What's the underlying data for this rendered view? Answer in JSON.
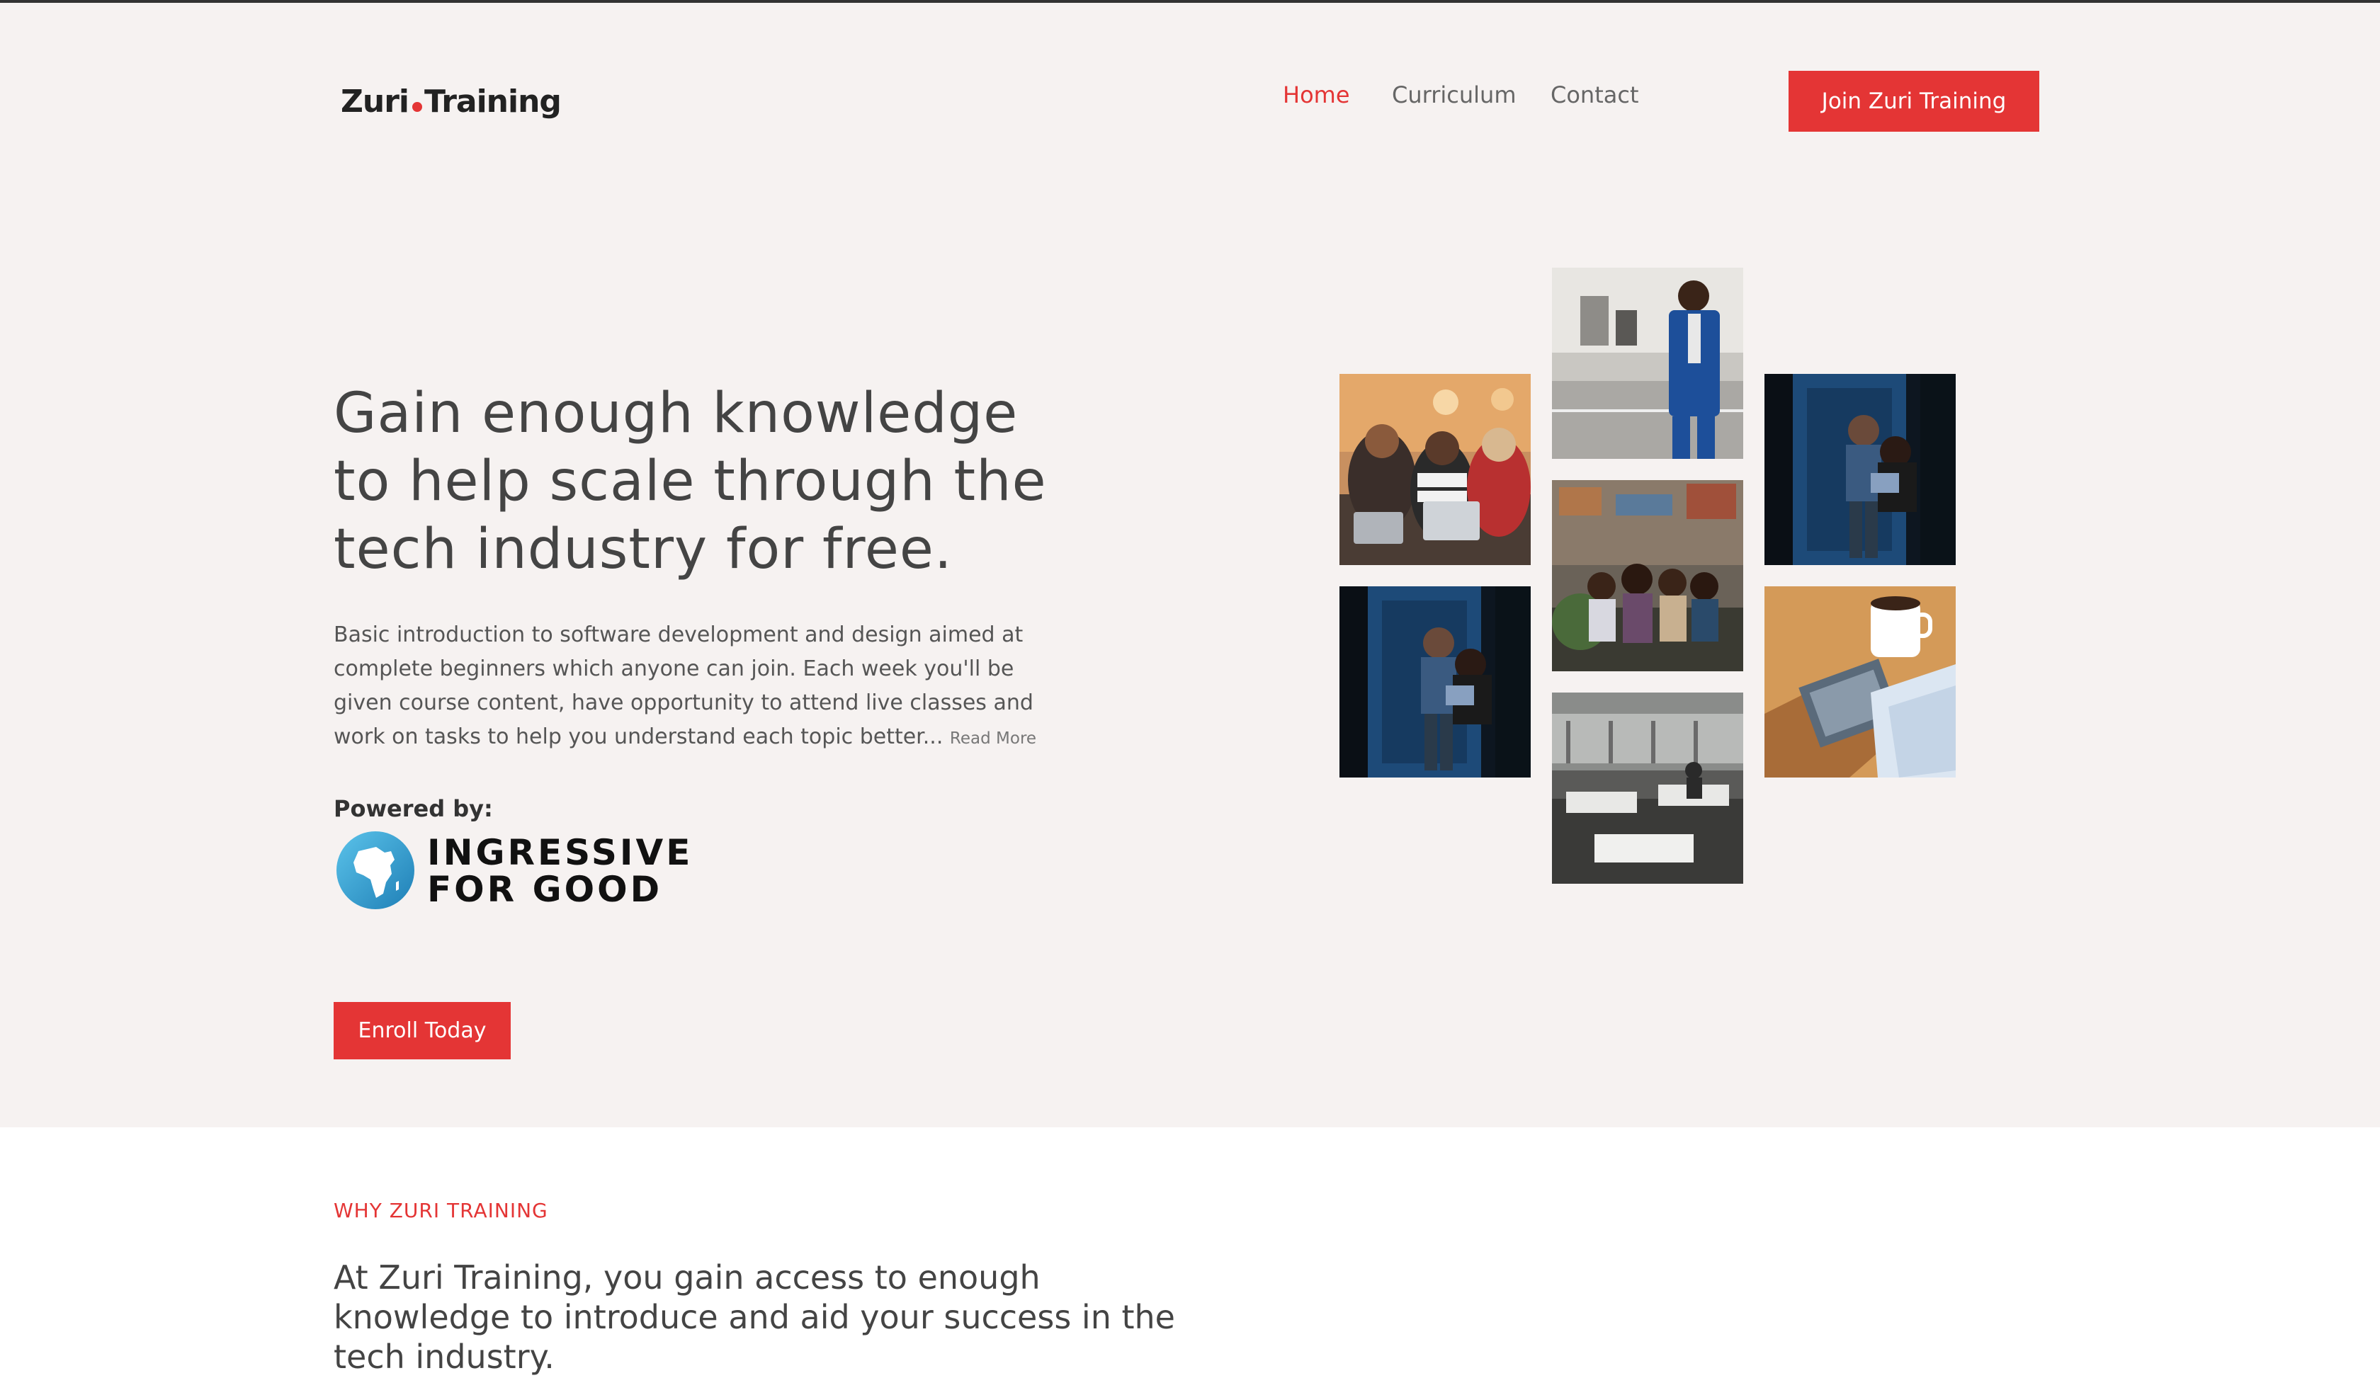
{
  "header": {
    "logo_left": "Zuri",
    "logo_right": "Training",
    "nav": [
      "Home",
      "Curriculum",
      "Contact"
    ],
    "cta_label": "Join Zuri Training"
  },
  "hero": {
    "title": "Gain enough knowledge to help scale through the tech industry for free.",
    "description": "Basic introduction to software development and design aimed at complete beginners which anyone can join. Each week you'll be given course content, have opportunity to attend live classes and work on tasks to help you understand each topic better...",
    "read_more": "Read More",
    "powered_by": "Powered by:",
    "partner_line1": "INGRESSIVE",
    "partner_line2": "FOR GOOD",
    "enroll_label": "Enroll Today"
  },
  "why": {
    "label": "WHY ZURI TRAINING",
    "text": "At Zuri Training, you gain access to enough knowledge to introduce and aid your success in the tech industry."
  },
  "colors": {
    "accent": "#e43535",
    "hero_bg": "#f6f2f1",
    "text": "#444444"
  }
}
